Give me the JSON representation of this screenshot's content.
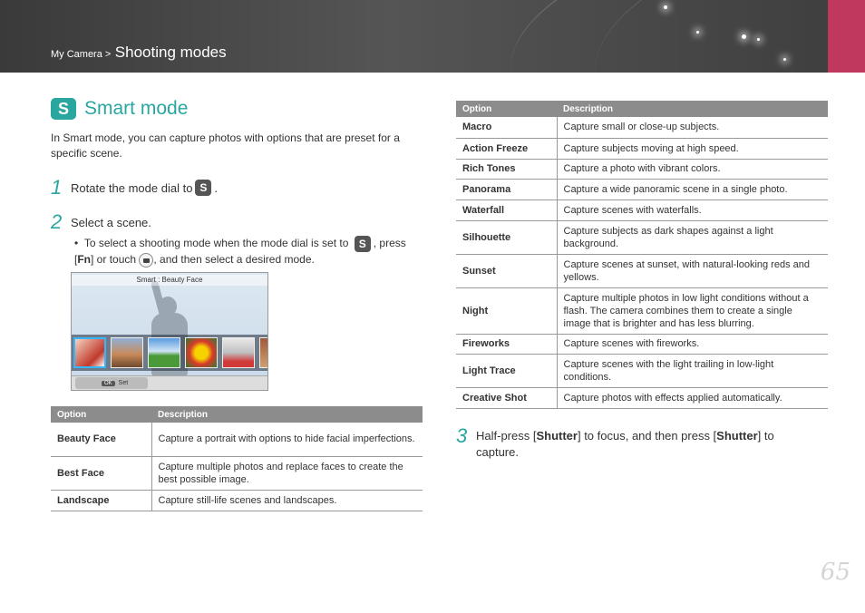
{
  "header": {
    "breadcrumb_prefix": "My Camera >",
    "breadcrumb_section": "Shooting modes",
    "accent_color": "#c0395c"
  },
  "title": {
    "icon_letter": "S",
    "text": "Smart mode",
    "color": "#2aa6a1"
  },
  "intro": "In Smart mode, you can capture photos with options that are preset for a specific scene.",
  "steps": {
    "one": {
      "num": "1",
      "text_before": "Rotate the mode dial to",
      "icon_letter": "S",
      "text_after": "."
    },
    "two": {
      "num": "2",
      "text": "Select a scene."
    },
    "three": {
      "num": "3",
      "p1": "Half-press [",
      "b1": "Shutter",
      "p2": "] to focus, and then press [",
      "b2": "Shutter",
      "p3": "] to capture."
    }
  },
  "bullet": {
    "p1": "To select a shooting mode when the mode dial is set to",
    "icon_letter": "S",
    "p2": ", press [",
    "fn": "Fn",
    "p3": "] or touch",
    "p4": ", and then select a desired mode."
  },
  "screen": {
    "title": "Smart : Beauty Face",
    "ok_label": "OK",
    "set_label": "Set"
  },
  "table_left": {
    "headers": [
      "Option",
      "Description"
    ],
    "rows": [
      {
        "option": "Beauty Face",
        "description": "Capture a portrait with options to hide facial imperfections."
      },
      {
        "option": "Best Face",
        "description": "Capture multiple photos and replace faces to create the best possible image."
      },
      {
        "option": "Landscape",
        "description": "Capture still-life scenes and landscapes."
      }
    ]
  },
  "table_right": {
    "headers": [
      "Option",
      "Description"
    ],
    "rows": [
      {
        "option": "Macro",
        "description": "Capture small or close-up subjects."
      },
      {
        "option": "Action Freeze",
        "description": "Capture subjects moving at high speed."
      },
      {
        "option": "Rich Tones",
        "description": "Capture a photo with vibrant colors."
      },
      {
        "option": "Panorama",
        "description": "Capture a wide panoramic scene in a single photo."
      },
      {
        "option": "Waterfall",
        "description": "Capture scenes with waterfalls."
      },
      {
        "option": "Silhouette",
        "description": "Capture subjects as dark shapes against a light background."
      },
      {
        "option": "Sunset",
        "description": "Capture scenes at sunset, with natural-looking reds and yellows."
      },
      {
        "option": "Night",
        "description": "Capture multiple photos in low light conditions without a flash. The camera combines them to create a single image that is brighter and has less blurring."
      },
      {
        "option": "Fireworks",
        "description": "Capture scenes with fireworks."
      },
      {
        "option": "Light Trace",
        "description": "Capture scenes with the light trailing in low-light conditions."
      },
      {
        "option": "Creative Shot",
        "description": "Capture photos with effects applied automatically."
      }
    ]
  },
  "page_number": "65"
}
